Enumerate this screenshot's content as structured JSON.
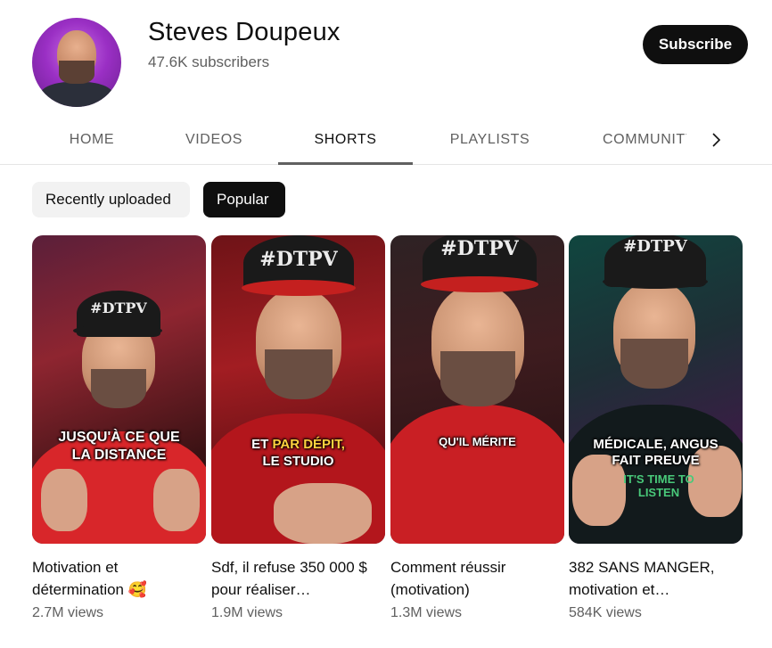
{
  "channel": {
    "name": "Steves Doupeux",
    "subscribers": "47.6K subscribers",
    "subscribe_label": "Subscribe"
  },
  "tabs": [
    {
      "label": "HOME",
      "active": false
    },
    {
      "label": "VIDEOS",
      "active": false
    },
    {
      "label": "SHORTS",
      "active": true
    },
    {
      "label": "PLAYLISTS",
      "active": false
    },
    {
      "label": "COMMUNITY",
      "active": false
    }
  ],
  "chips": [
    {
      "label": "Recently uploaded",
      "active": false
    },
    {
      "label": "Popular",
      "active": true
    }
  ],
  "shorts": [
    {
      "title": "Motivation et détermination 🥰",
      "views": "2.7M views",
      "caption_line1": "JUSQU'À CE QUE",
      "caption_line2": "LA DISTANCE",
      "hat_text": "#DTPV"
    },
    {
      "title": "Sdf, il refuse 350 000 $ pour réaliser…",
      "views": "1.9M views",
      "caption_line1_pre": "ET ",
      "caption_line1_accent": "PAR DÉPIT,",
      "caption_line2": "LE STUDIO",
      "hat_text": "#DTPV"
    },
    {
      "title": "Comment réussir (motivation)",
      "views": "1.3M views",
      "caption_line1": "QU'IL MÉRITE",
      "hat_text": "#DTPV"
    },
    {
      "title": "382 SANS MANGER, motivation et…",
      "views": "584K views",
      "caption_line1": "MÉDICALE, ANGUS",
      "caption_line2": "FAIT PREUVE",
      "hat_text": "#DTPV",
      "shirt_text": "IT'S TIME TO LISTEN"
    }
  ],
  "icons": {
    "chevron": "chevron-right-icon"
  },
  "colors": {
    "subscribe_bg": "#0f0f0f",
    "active_chip_bg": "#0f0f0f",
    "inactive_chip_bg": "#f2f2f2",
    "caption_accent": "#ffd23f"
  }
}
